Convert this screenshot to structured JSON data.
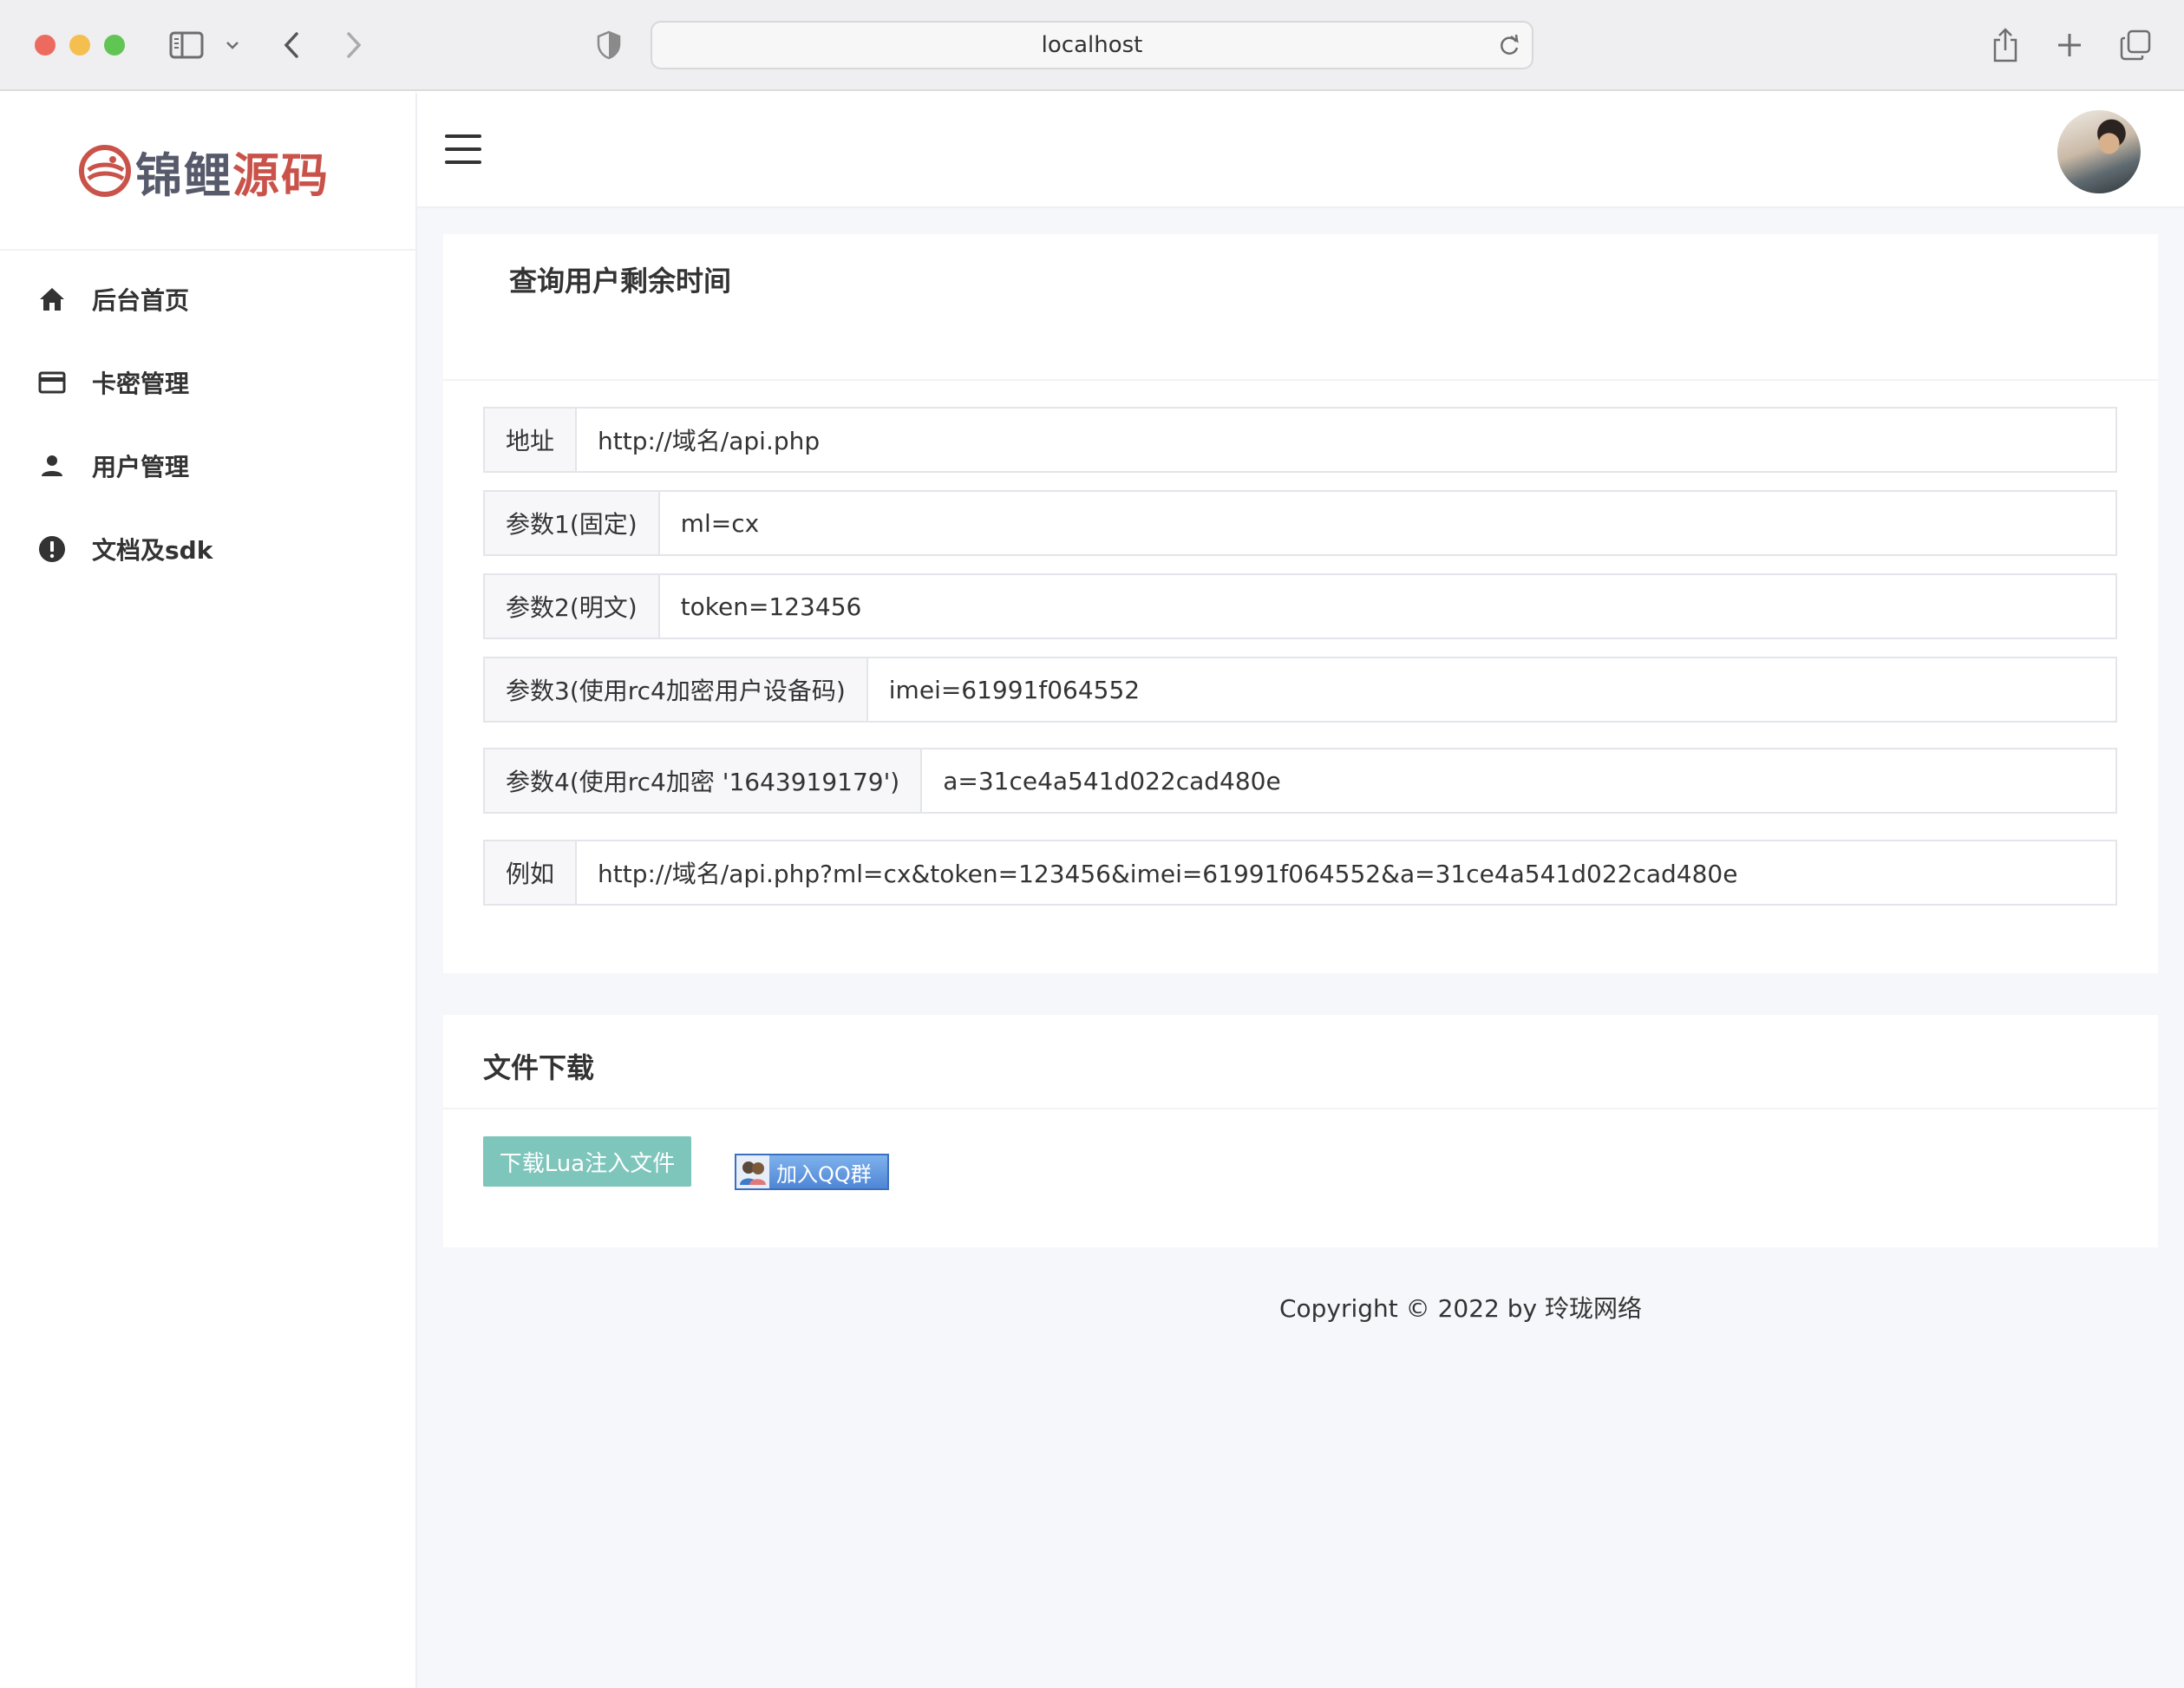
{
  "browser": {
    "url": "localhost"
  },
  "sidebar": {
    "logo": {
      "part1": "锦鲤",
      "part2": "源码"
    },
    "items": [
      {
        "label": "后台首页",
        "icon": "home-icon"
      },
      {
        "label": "卡密管理",
        "icon": "card-icon"
      },
      {
        "label": "用户管理",
        "icon": "user-icon"
      },
      {
        "label": "文档及sdk",
        "icon": "alert-circle-icon"
      }
    ]
  },
  "query_card": {
    "title": "查询用户剩余时间",
    "fields": [
      {
        "label": "地址",
        "value": "http://域名/api.php"
      },
      {
        "label": "参数1(固定)",
        "value": "ml=cx"
      },
      {
        "label": "参数2(明文)",
        "value": "token=123456"
      },
      {
        "label": "参数3(使用rc4加密用户设备码)",
        "value": "imei=61991f064552"
      },
      {
        "label": "参数4(使用rc4加密 '1643919179')",
        "value": "a=31ce4a541d022cad480e"
      },
      {
        "label": "例如",
        "value": "http://域名/api.php?ml=cx&token=123456&imei=61991f064552&a=31ce4a541d022cad480e"
      }
    ]
  },
  "download_card": {
    "title": "文件下载",
    "download_button": "下载Lua注入文件",
    "qq_button": "加入QQ群"
  },
  "footer": {
    "copyright": "Copyright © 2022 by 玲珑网络"
  },
  "colors": {
    "download_button": "#7ec5bb",
    "logo_dark": "#565a6a",
    "logo_red": "#c9534a",
    "background": "#f6f7fb"
  }
}
